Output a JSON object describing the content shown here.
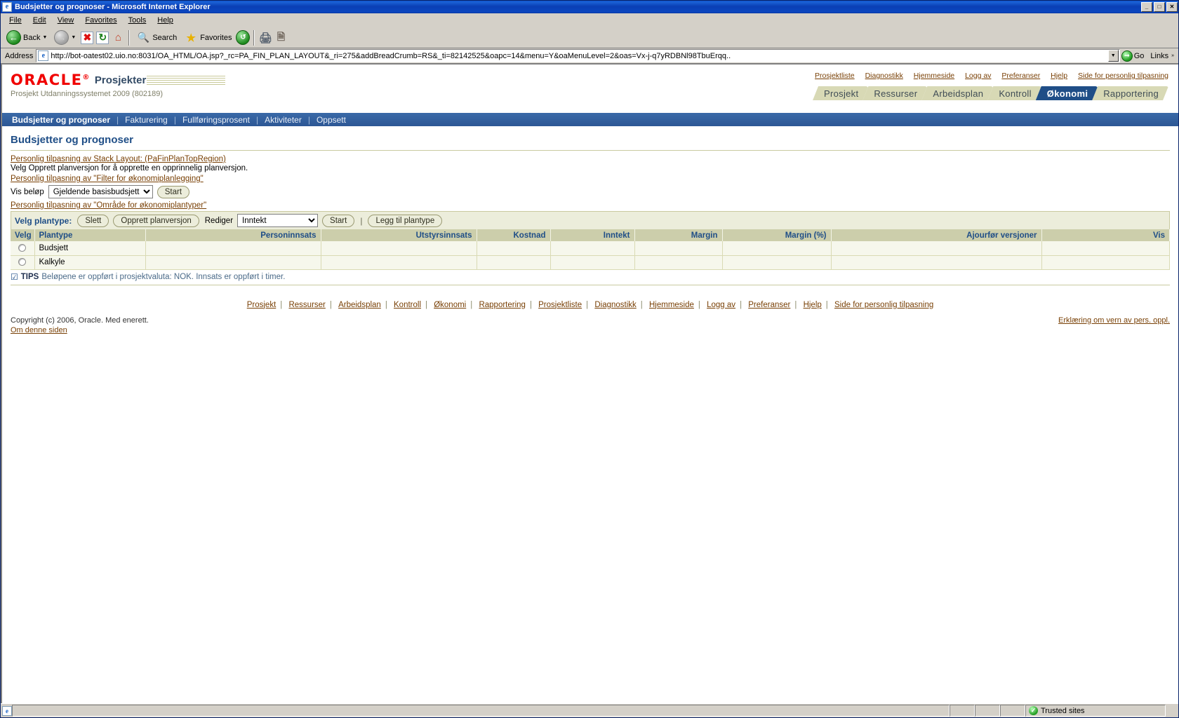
{
  "window": {
    "title": "Budsjetter og prognoser - Microsoft Internet Explorer",
    "icon": "ie-document-icon",
    "minimize_label": "_",
    "maximize_label": "□",
    "close_label": "✕"
  },
  "menubar": {
    "items": [
      {
        "label": "File"
      },
      {
        "label": "Edit"
      },
      {
        "label": "View"
      },
      {
        "label": "Favorites"
      },
      {
        "label": "Tools"
      },
      {
        "label": "Help"
      }
    ]
  },
  "toolbar": {
    "back_label": "Back",
    "forward_label": "",
    "stop_label": "",
    "refresh_label": "",
    "home_label": "",
    "search_label": "Search",
    "favorites_label": "Favorites",
    "history_label": "",
    "print_label": "",
    "edit_label": ""
  },
  "address": {
    "label": "Address",
    "url": "http://bot-oatest02.uio.no:8031/OA_HTML/OA.jsp?_rc=PA_FIN_PLAN_LAYOUT&_ri=275&addBreadCrumb=RS&_ti=82142525&oapc=14&menu=Y&oaMenuLevel=2&oas=Vx-j-q7yRDBNl98TbuErqq..",
    "go_label": "Go",
    "links_label": "Links"
  },
  "branding": {
    "logo": "ORACLE",
    "app_name": "Prosjekter",
    "project_line": "Prosjekt Utdanningssystemet 2009 (802189)"
  },
  "global_links": [
    {
      "label": "Prosjektliste"
    },
    {
      "label": "Diagnostikk"
    },
    {
      "label": "Hjemmeside"
    },
    {
      "label": "Logg av"
    },
    {
      "label": "Preferanser"
    },
    {
      "label": "Hjelp"
    },
    {
      "label": "Side for personlig tilpasning"
    }
  ],
  "tabs": [
    {
      "label": "Prosjekt",
      "selected": false
    },
    {
      "label": "Ressurser",
      "selected": false
    },
    {
      "label": "Arbeidsplan",
      "selected": false
    },
    {
      "label": "Kontroll",
      "selected": false
    },
    {
      "label": "Økonomi",
      "selected": true
    },
    {
      "label": "Rapportering",
      "selected": false
    }
  ],
  "subnav": [
    {
      "label": "Budsjetter og prognoser",
      "active": true
    },
    {
      "label": "Fakturering",
      "active": false
    },
    {
      "label": "Fullføringsprosent",
      "active": false
    },
    {
      "label": "Aktiviteter",
      "active": false
    },
    {
      "label": "Oppsett",
      "active": false
    }
  ],
  "main": {
    "page_title": "Budsjetter og prognoser",
    "personalize_stack_layout": "Personlig tilpasning av Stack Layout: (PaFinPlanTopRegion)",
    "instruction": "Velg Opprett planversjon for å opprette en opprinnelig planversjon.",
    "personalize_filter": "Personlig tilpasning av \"Filter for økonomiplanlegging\"",
    "vis_belop_label": "Vis beløp",
    "vis_belop_value": "Gjeldende basisbudsjett",
    "vis_belop_options": [
      "Gjeldende basisbudsjett"
    ],
    "start_label": "Start",
    "personalize_plantype_area": "Personlig tilpasning av \"Område for økonomiplantyper\""
  },
  "action_bar": {
    "velg_plantype_label": "Velg plantype:",
    "slett_label": "Slett",
    "opprett_planversjon_label": "Opprett planversjon",
    "rediger_label": "Rediger",
    "rediger_value": "Inntekt",
    "rediger_options": [
      "Inntekt"
    ],
    "start_label": "Start",
    "separator": "|",
    "legg_til_plantype_label": "Legg til plantype"
  },
  "table": {
    "columns": [
      {
        "label": "Velg",
        "align": "left"
      },
      {
        "label": "Plantype",
        "align": "left"
      },
      {
        "label": "Personinnsats",
        "align": "right"
      },
      {
        "label": "Utstyrsinnsats",
        "align": "right"
      },
      {
        "label": "Kostnad",
        "align": "right"
      },
      {
        "label": "Inntekt",
        "align": "right"
      },
      {
        "label": "Margin",
        "align": "right"
      },
      {
        "label": "Margin (%)",
        "align": "right"
      },
      {
        "label": "Ajourfør versjoner",
        "align": "right"
      },
      {
        "label": "Vis",
        "align": "right"
      }
    ],
    "rows": [
      {
        "select": "",
        "plantype": "Budsjett",
        "personinnsats": "",
        "utstyrsinnsats": "",
        "kostnad": "",
        "inntekt": "",
        "margin": "",
        "margin_pct": "",
        "ajourfor_versjoner": "",
        "vis": ""
      },
      {
        "select": "",
        "plantype": "Kalkyle",
        "personinnsats": "",
        "utstyrsinnsats": "",
        "kostnad": "",
        "inntekt": "",
        "margin": "",
        "margin_pct": "",
        "ajourfor_versjoner": "",
        "vis": ""
      }
    ]
  },
  "tips": {
    "icon": "tip-check-icon",
    "label": "TIPS",
    "text": "Beløpene er oppført i prosjektvaluta: NOK. Innsats er oppført i timer."
  },
  "footer": {
    "links": [
      {
        "label": "Prosjekt"
      },
      {
        "label": "Ressurser"
      },
      {
        "label": "Arbeidsplan"
      },
      {
        "label": "Kontroll"
      },
      {
        "label": "Økonomi"
      },
      {
        "label": "Rapportering"
      },
      {
        "label": "Prosjektliste"
      },
      {
        "label": "Diagnostikk"
      },
      {
        "label": "Hjemmeside"
      },
      {
        "label": "Logg av"
      },
      {
        "label": "Preferanser"
      },
      {
        "label": "Hjelp"
      },
      {
        "label": "Side for personlig tilpasning"
      }
    ],
    "copyright": "Copyright (c) 2006, Oracle. Med enerett.",
    "about_link": "Om denne siden",
    "privacy_link": "Erklæring om vern av pers. oppl."
  },
  "statusbar": {
    "message": "",
    "zone": "Trusted sites",
    "zone_icon": "lock-icon"
  }
}
